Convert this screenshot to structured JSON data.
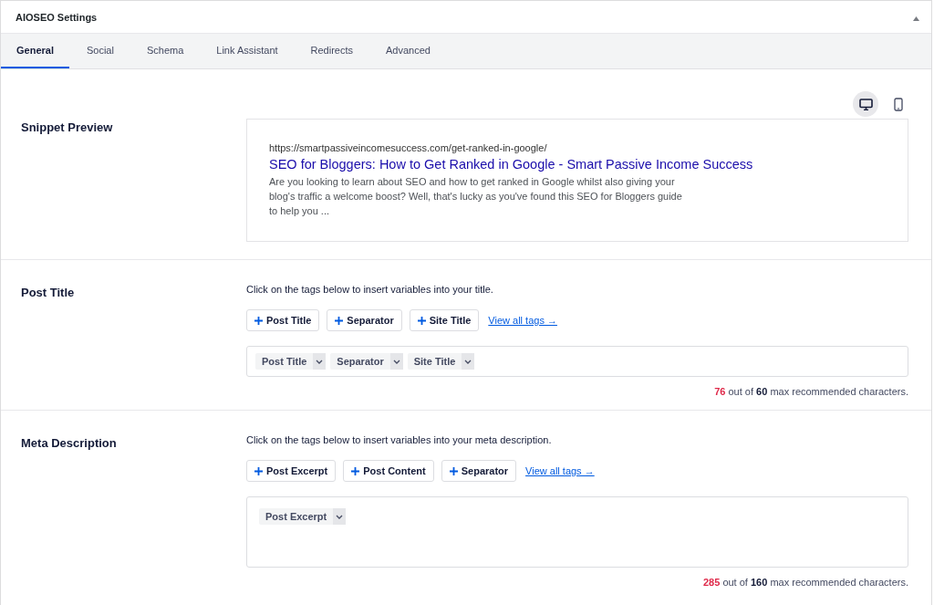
{
  "panel": {
    "title": "AIOSEO Settings",
    "expanded": true
  },
  "tabs": [
    {
      "label": "General",
      "selected": true
    },
    {
      "label": "Social",
      "selected": false
    },
    {
      "label": "Schema",
      "selected": false
    },
    {
      "label": "Link Assistant",
      "selected": false
    },
    {
      "label": "Redirects",
      "selected": false
    },
    {
      "label": "Advanced",
      "selected": false
    }
  ],
  "preview_devices": [
    {
      "kind": "desktop",
      "selected": true
    },
    {
      "kind": "mobile",
      "selected": false
    }
  ],
  "snippet_preview": {
    "label": "Snippet Preview",
    "url": "https://smartpassiveincomesuccess.com/get-ranked-in-google/",
    "title": "SEO for Bloggers: How to Get Ranked in Google - Smart Passive Income Success",
    "description": "Are you looking to learn about SEO and how to get ranked in Google whilst also giving your blog's traffic a welcome boost? Well, that's lucky as you've found this SEO for Bloggers guide to help you ..."
  },
  "sections": [
    {
      "label": "Post Title",
      "kind": "single-line",
      "hint": "Click on the tags below to insert variables into your title.",
      "add_tags": [
        "Post Title",
        "Separator",
        "Site Title"
      ],
      "view_all": "View all tags →",
      "field_tags": [
        "Post Title",
        "Separator",
        "Site Title"
      ],
      "counter": {
        "count": "76",
        "over": true,
        "middle": "out of",
        "max": "60",
        "suffix": "max recommended characters."
      }
    },
    {
      "label": "Meta Description",
      "kind": "multi-line",
      "hint": "Click on the tags below to insert variables into your meta description.",
      "add_tags": [
        "Post Excerpt",
        "Post Content",
        "Separator"
      ],
      "view_all": "View all tags →",
      "field_tags": [
        "Post Excerpt"
      ],
      "counter": {
        "count": "285",
        "over": true,
        "middle": "out of",
        "max": "160",
        "suffix": "max recommended characters."
      }
    }
  ]
}
